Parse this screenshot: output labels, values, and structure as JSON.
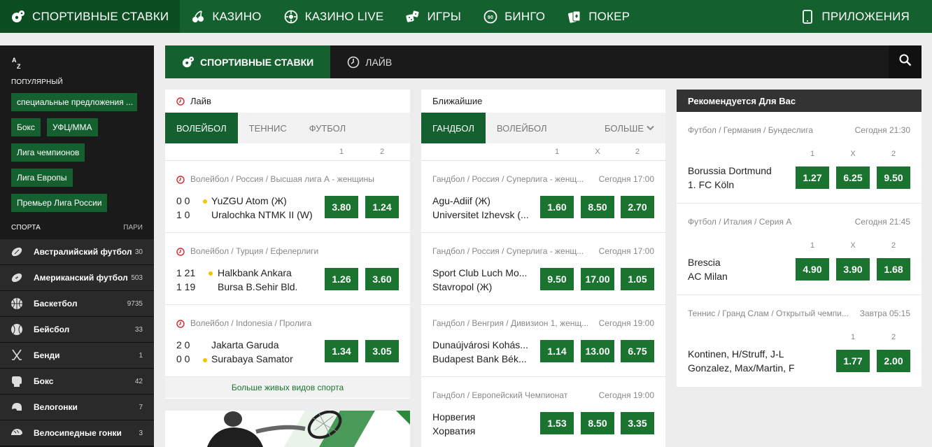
{
  "topnav": {
    "items": [
      {
        "label": "СПОРТИВНЫЕ СТАВКИ",
        "icon": "soccer-ball-icon"
      },
      {
        "label": "КАЗИНО",
        "icon": "cherries-icon"
      },
      {
        "label": "КАЗИНО LIVE",
        "icon": "roulette-icon"
      },
      {
        "label": "ИГРЫ",
        "icon": "dice-icon"
      },
      {
        "label": "БИНГО",
        "icon": "bingo-ball-icon"
      },
      {
        "label": "ПОКЕР",
        "icon": "playing-cards-icon"
      }
    ],
    "apps_label": "ПРИЛОЖЕНИЯ"
  },
  "sidebar": {
    "az": {
      "a": "A",
      "z": "Z"
    },
    "popular_label": "ПОПУЛЯРНЫЙ",
    "chips": [
      "специальные предложения ...",
      "Бокс",
      "УФЦ/ММА",
      "Лига чемпионов",
      "Лига Европы",
      "Премьер Лига России"
    ],
    "sports_label": "СПОРТА",
    "bets_label": "ПАРИ",
    "sports": [
      {
        "name": "Австралийский футбол",
        "count": "30",
        "icon": "rugby-ball-icon"
      },
      {
        "name": "Американский футбол",
        "count": "503",
        "icon": "american-football-icon"
      },
      {
        "name": "Баскетбол",
        "count": "9735",
        "icon": "basketball-icon"
      },
      {
        "name": "Бейсбол",
        "count": "33",
        "icon": "baseball-icon"
      },
      {
        "name": "Бенди",
        "count": "1",
        "icon": "hockey-sticks-icon"
      },
      {
        "name": "Бокс",
        "count": "42",
        "icon": "boxing-glove-icon"
      },
      {
        "name": "Велогонки",
        "count": "7",
        "icon": "helmet-icon"
      },
      {
        "name": "Велосипедные гонки",
        "count": "3",
        "icon": "bike-helmet-icon"
      }
    ]
  },
  "mainbar": {
    "sports_tab": "СПОРТИВНЫЕ СТАВКИ",
    "live_tab": "ЛАЙВ"
  },
  "live": {
    "title": "Лайв",
    "tabs": [
      "ВОЛЕЙБОЛ",
      "ТЕННИС",
      "ФУТБОЛ"
    ],
    "col1": "1",
    "col2": "2",
    "events": [
      {
        "league": "Волейбол / Россия / Высшая лига А - женщины",
        "score1": "0 0",
        "score2": "1 0",
        "team1": "YuZGU Atom (Ж)",
        "team2": "Uralochka NTMK II (W)",
        "odd1": "3.80",
        "odd2": "1.24"
      },
      {
        "league": "Волейбол / Турция / Ефелерлиги",
        "score1": "1 21",
        "score2": "1 19",
        "team1": "Halkbank Ankara",
        "team2": "Bursa B.Sehir Bld.",
        "odd1": "1.26",
        "odd2": "3.60"
      },
      {
        "league": "Волейбол / Indonesia / Пролига",
        "score1": "2 0",
        "score2": "0 0",
        "team1": "Jakarta Garuda",
        "team2": "Surabaya Samator",
        "odd1": "1.34",
        "odd2": "3.05"
      }
    ],
    "more": "Больше живых видов спорта"
  },
  "upcoming": {
    "title": "Ближайшие",
    "tabs": [
      "ГАНДБОЛ",
      "ВОЛЕЙБОЛ"
    ],
    "more_tab": "БОЛЬШЕ",
    "col1": "1",
    "colx": "X",
    "col2": "2",
    "events": [
      {
        "league": "Гандбол / Россия / Суперлига - женщ...",
        "time": "Сегодня 17:00",
        "team1": "Agu-Adiif (Ж)",
        "team2": "Universitet Izhevsk (...",
        "o1": "1.60",
        "ox": "8.50",
        "o2": "2.70"
      },
      {
        "league": "Гандбол / Россия / Суперлига - женщ...",
        "time": "Сегодня 17:00",
        "team1": "Sport Club Luch Mo...",
        "team2": "Stavropol (Ж)",
        "o1": "9.50",
        "ox": "17.00",
        "o2": "1.05"
      },
      {
        "league": "Гандбол / Венгрия / Дивизион 1, женщ...",
        "time": "Сегодня 19:00",
        "team1": "Dunaújvárosi Kohás...",
        "team2": "Budapest Bank Bék...",
        "o1": "1.14",
        "ox": "13.00",
        "o2": "6.75"
      },
      {
        "league": "Гандбол / Европейский Чемпионат",
        "time": "Сегодня 19:00",
        "team1": "Норвегия",
        "team2": "Хорватия",
        "o1": "1.53",
        "ox": "8.50",
        "o2": "3.35"
      }
    ]
  },
  "recommended": {
    "title": "Рекомендуется Для Вас",
    "events": [
      {
        "league": "Футбол / Германия / Бундеслига",
        "time": "Сегодня 21:30",
        "team1": "Borussia Dortmund",
        "team2": "1. FC Köln",
        "h1": "1",
        "hx": "X",
        "h2": "2",
        "o1": "1.27",
        "ox": "6.25",
        "o2": "9.50"
      },
      {
        "league": "Футбол / Италия / Серия А",
        "time": "Сегодня 21:45",
        "team1": "Brescia",
        "team2": "AC Milan",
        "h1": "1",
        "hx": "X",
        "h2": "2",
        "o1": "4.90",
        "ox": "3.90",
        "o2": "1.68"
      },
      {
        "league": "Теннис / Гранд Слам / Открытый чемпи...",
        "time": "Завтра 05:15",
        "team1": "Kontinen, H/Struff, J-L",
        "team2": "Gonzalez, Max/Martin, F",
        "h1": "1",
        "h2": "2",
        "o1": "1.77",
        "o2": "2.00"
      }
    ]
  }
}
